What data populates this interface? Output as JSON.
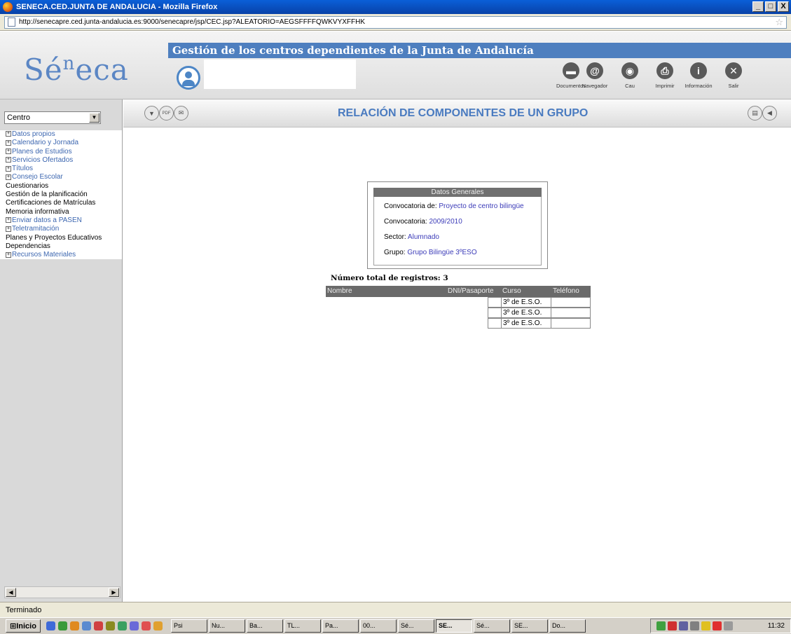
{
  "window": {
    "title": "SENECA.CED.JUNTA DE ANDALUCIA - Mozilla Firefox",
    "min": "_",
    "max": "□",
    "close": "X"
  },
  "address": {
    "url": "http://senecapre.ced.junta-andalucia.es:9000/senecapre/jsp/CEC.jsp?ALEATORIO=AEGSFFFFQWKVYXFFHK"
  },
  "header": {
    "banner": "Gestión de los centros dependientes de la Junta de Andalucía",
    "logo_main": "Sé",
    "logo_sup": "n",
    "logo_rest": "eca",
    "tools": [
      {
        "label": "Documentos",
        "icon": "document-icon"
      },
      {
        "label": "Navegador",
        "icon": "at-icon"
      },
      {
        "label": "Cau",
        "icon": "support-icon"
      },
      {
        "label": "Imprimir",
        "icon": "printer-icon"
      },
      {
        "label": "Información",
        "icon": "info-icon"
      },
      {
        "label": "Salir",
        "icon": "close-icon"
      }
    ]
  },
  "sidebar": {
    "select_value": "Centro",
    "items": [
      {
        "label": "Datos propios",
        "type": "link"
      },
      {
        "label": "Calendario y Jornada",
        "type": "link"
      },
      {
        "label": "Planes de Estudios",
        "type": "link"
      },
      {
        "label": "Servicios Ofertados",
        "type": "link"
      },
      {
        "label": "Títulos",
        "type": "link"
      },
      {
        "label": "Consejo Escolar",
        "type": "link"
      },
      {
        "label": "Cuestionarios",
        "type": "plain"
      },
      {
        "label": "Gestión de la planificación",
        "type": "plain"
      },
      {
        "label": "Certificaciones de Matrículas",
        "type": "plain"
      },
      {
        "label": "Memoria informativa",
        "type": "plain"
      },
      {
        "label": "Enviar datos a PASEN",
        "type": "link"
      },
      {
        "label": "Teletramitación",
        "type": "link"
      },
      {
        "label": "Planes y Proyectos Educativos",
        "type": "plain"
      },
      {
        "label": "Dependencias",
        "type": "plain"
      },
      {
        "label": "Recursos Materiales",
        "type": "link"
      }
    ]
  },
  "main": {
    "title": "RELACIÓN DE COMPONENTES DE UN GRUPO",
    "card": {
      "heading": "Datos Generales",
      "rows": [
        {
          "label": "Convocatoria de:",
          "value": "Proyecto de centro bilingüe"
        },
        {
          "label": "Convocatoria:",
          "value": "2009/2010"
        },
        {
          "label": "Sector:",
          "value": "Alumnado"
        },
        {
          "label": "Grupo:",
          "value": "Grupo Bilingüe 3ºESO"
        }
      ]
    },
    "count_text": "Número total de registros: 3",
    "table": {
      "columns": [
        "Nombre",
        "DNI/Pasaporte",
        "Curso",
        "Teléfono"
      ],
      "rows": [
        {
          "curso": "3º de E.S.O."
        },
        {
          "curso": "3º de E.S.O."
        },
        {
          "curso": "3º de E.S.O."
        }
      ]
    }
  },
  "status": {
    "text": "Terminado"
  },
  "taskbar": {
    "start": "Inicio",
    "tasks": [
      "Psi",
      "Nu...",
      "Ba...",
      "TL...",
      "Pa...",
      "00...",
      "Sé...",
      "SE...",
      "Sé...",
      "SE...",
      "Do..."
    ],
    "active_index": 7,
    "clock": "11:32"
  }
}
